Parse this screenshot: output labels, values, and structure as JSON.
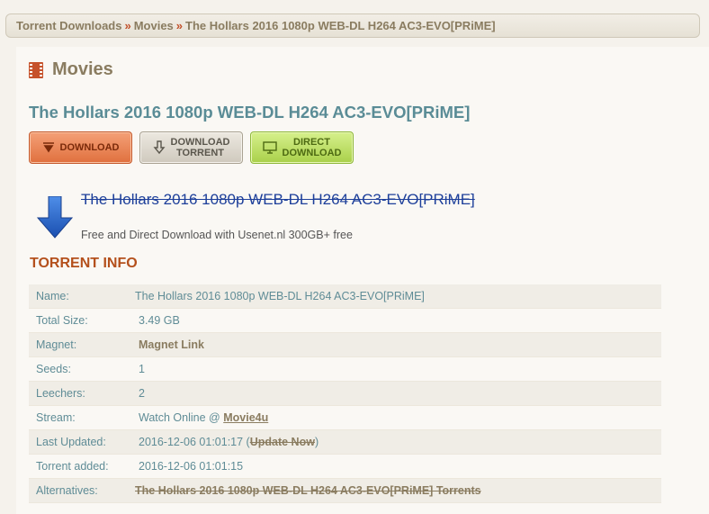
{
  "breadcrumb": {
    "items": [
      "Torrent Downloads",
      "Movies",
      "The Hollars 2016 1080p WEB-DL H264 AC3-EVO[PRiME]"
    ],
    "separator": "»"
  },
  "section": {
    "title": "Movies",
    "icon": "film-icon"
  },
  "torrent": {
    "title": "The Hollars 2016 1080p WEB-DL H264 AC3-EVO[PRiME]"
  },
  "buttons": {
    "download": "Download",
    "download_torrent_1": "Download",
    "download_torrent_2": "Torrent",
    "direct_1": "Direct",
    "direct_2": "Download"
  },
  "usenet": {
    "link": "The Hollars 2016 1080p WEB-DL H264 AC3-EVO[PRiME]",
    "sub": "Free and Direct Download with Usenet.nl 300GB+ free"
  },
  "info": {
    "heading": "TORRENT INFO",
    "name_label": "Name:",
    "name_value": "The Hollars 2016 1080p WEB-DL H264 AC3-EVO[PRiME]",
    "size_label": "Total Size:",
    "size_value": "3.49 GB",
    "magnet_label": "Magnet:",
    "magnet_value": "Magnet Link",
    "seeds_label": "Seeds:",
    "seeds_value": "1",
    "leechers_label": "Leechers:",
    "leechers_value": "2",
    "stream_label": "Stream:",
    "stream_prefix": "Watch Online @",
    "stream_link": "Movie4u",
    "updated_label": "Last Updated:",
    "updated_value": "2016-12-06 01:01:17",
    "update_now": "Update Now",
    "added_label": "Torrent added:",
    "added_value": "2016-12-06 01:01:15",
    "alternatives_label": "Alternatives:",
    "alternatives_value": "The Hollars 2016 1080p WEB-DL H264 AC3-EVO[PRiME] Torrents"
  },
  "colors": {
    "accent": "#5a8c96",
    "heading_orange": "#b4501c",
    "brown": "#8a7c60"
  }
}
